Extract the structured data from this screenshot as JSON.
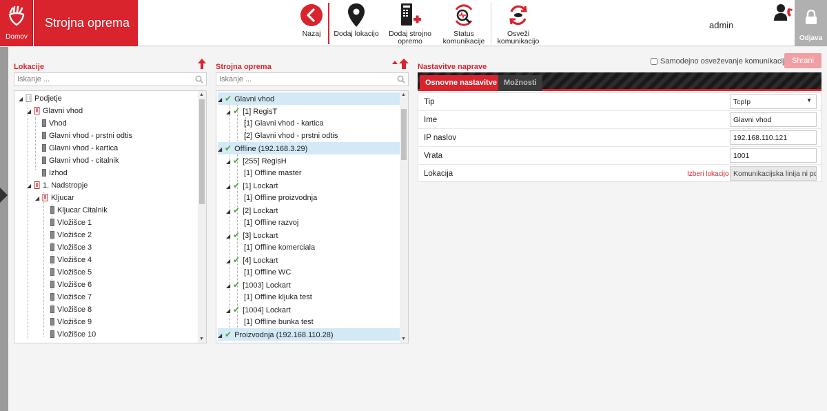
{
  "header": {
    "home_label": "Domov",
    "app_title": "Strojna oprema",
    "toolbar": [
      {
        "label": "Nazaj",
        "icon": "back-icon"
      },
      {
        "label": "Dodaj lokacijo",
        "icon": "map-pin-icon"
      },
      {
        "label": "Dodaj strojno opremo",
        "icon": "add-device-icon"
      },
      {
        "label": "Status komunikacije",
        "icon": "status-icon"
      },
      {
        "label": "Osveži komunikacijo",
        "icon": "refresh-icon"
      }
    ],
    "user": "admin",
    "logout_label": "Odjava"
  },
  "locations": {
    "title": "Lokacije",
    "search_placeholder": "Iskanje ...",
    "tree": [
      {
        "label": "Podjetje",
        "icon": "building-icon"
      },
      {
        "label": "Glavni vhod",
        "icon": "group-icon"
      },
      {
        "label": "Vhod",
        "icon": "door-icon"
      },
      {
        "label": "Glavni vhod - prstni odtis",
        "icon": "door-icon"
      },
      {
        "label": "Glavni vhod - kartica",
        "icon": "door-icon"
      },
      {
        "label": "Glavni vhod - citalnik",
        "icon": "door-icon"
      },
      {
        "label": "Izhod",
        "icon": "door-icon"
      },
      {
        "label": "1. Nadstropje",
        "icon": "group-icon"
      },
      {
        "label": "Kljucar",
        "icon": "group-icon"
      },
      {
        "label": "Kljucar Citalnik",
        "icon": "door-icon"
      },
      {
        "label": "Vložišce 1",
        "icon": "door-icon"
      },
      {
        "label": "Vložišce 2",
        "icon": "door-icon"
      },
      {
        "label": "Vložišce 3",
        "icon": "door-icon"
      },
      {
        "label": "Vložišce 4",
        "icon": "door-icon"
      },
      {
        "label": "Vložišce 5",
        "icon": "door-icon"
      },
      {
        "label": "Vložišce 6",
        "icon": "door-icon"
      },
      {
        "label": "Vložišce 7",
        "icon": "door-icon"
      },
      {
        "label": "Vložišce 8",
        "icon": "door-icon"
      },
      {
        "label": "Vložišce 9",
        "icon": "door-icon"
      },
      {
        "label": "Vložišce 10",
        "icon": "door-icon"
      }
    ]
  },
  "hardware": {
    "title": "Strojna oprema",
    "search_placeholder": "Iskanje ...",
    "tree": [
      {
        "label": "Glavni vhod",
        "check": true,
        "highlight": true
      },
      {
        "label": "[1] RegisT",
        "check": true
      },
      {
        "label": "[1] Glavni vhod - kartica",
        "check": false
      },
      {
        "label": "[2] Glavni vhod - prstni odtis",
        "check": false
      },
      {
        "label": "Offline (192.168.3.29)",
        "check": true,
        "highlight": true
      },
      {
        "label": "[255] RegisH",
        "check": true
      },
      {
        "label": "[1] Offline master",
        "check": false
      },
      {
        "label": "[1] Lockart",
        "check": true
      },
      {
        "label": "[1] Offline proizvodnja",
        "check": false
      },
      {
        "label": "[2] Lockart",
        "check": true
      },
      {
        "label": "[1] Offline razvoj",
        "check": false
      },
      {
        "label": "[3] Lockart",
        "check": true
      },
      {
        "label": "[1] Offline komerciala",
        "check": false
      },
      {
        "label": "[4] Lockart",
        "check": true
      },
      {
        "label": "[1] Offline WC",
        "check": false
      },
      {
        "label": "[1003] Lockart",
        "check": true
      },
      {
        "label": "[1] Offline kljuka test",
        "check": false
      },
      {
        "label": "[1004] Lockart",
        "check": true
      },
      {
        "label": "[1] Offline bunka test",
        "check": false
      },
      {
        "label": "Proizvodnja (192.168.110.28)",
        "check": true,
        "highlight": true
      }
    ]
  },
  "settings": {
    "title": "Nastavitve naprave",
    "auto_refresh_label": "Samodejno osveževanje komunikacije",
    "save_label": "Shrani",
    "tabs": [
      "Osnovne nastavitve",
      "Možnosti"
    ],
    "fields": [
      {
        "label": "Tip",
        "value": "TcpIp",
        "type": "select"
      },
      {
        "label": "Ime",
        "value": "Glavni vhod",
        "type": "text"
      },
      {
        "label": "IP naslov",
        "value": "192.168.110.121",
        "type": "text"
      },
      {
        "label": "Vrata",
        "value": "1001",
        "type": "text"
      },
      {
        "label": "Lokacija",
        "value": "Komunikacijska linija ni pc",
        "type": "readonly",
        "action": "Izberi lokacijo"
      }
    ]
  },
  "colors": {
    "accent": "#d9232d",
    "check": "#46a83b",
    "highlight": "#d3e9f6"
  }
}
